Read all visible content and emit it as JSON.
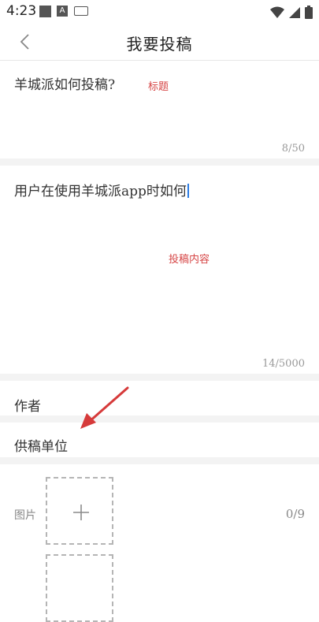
{
  "status_bar": {
    "time": "4:23",
    "a_badge": "A"
  },
  "header": {
    "title": "我要投稿"
  },
  "title_field": {
    "value": "羊城派如何投稿?",
    "annotation": "标题",
    "counter": "8/50"
  },
  "content_field": {
    "value": "用户在使用羊城派app时如何",
    "annotation": "投稿内容",
    "counter": "14/5000"
  },
  "author_field": {
    "placeholder": "作者"
  },
  "unit_field": {
    "placeholder": "供稿单位"
  },
  "image_section": {
    "label": "图片",
    "count": "0/9"
  },
  "colors": {
    "annotation_red": "#d64545",
    "caret_blue": "#2a7be4",
    "separator_gray": "#f3f3f3"
  },
  "icons": [
    "back-chevron-icon",
    "plus-icon",
    "wifi-icon",
    "signal-icon",
    "battery-icon",
    "keyboard-icon"
  ]
}
